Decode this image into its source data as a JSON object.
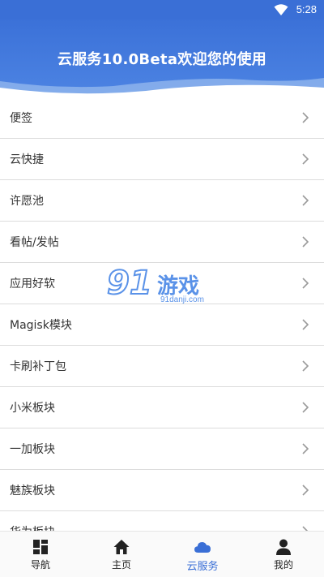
{
  "status": {
    "time": "5:28"
  },
  "header": {
    "title": "云服务10.0Beta欢迎您的使用"
  },
  "list": {
    "items": [
      {
        "label": "便签"
      },
      {
        "label": "云快捷"
      },
      {
        "label": "许愿池"
      },
      {
        "label": "看帖/发帖"
      },
      {
        "label": "应用好软"
      },
      {
        "label": "Magisk模块"
      },
      {
        "label": "卡刷补丁包"
      },
      {
        "label": "小米板块"
      },
      {
        "label": "一加板块"
      },
      {
        "label": "魅族板块"
      },
      {
        "label": "华为板块"
      }
    ]
  },
  "watermark": {
    "number": "91",
    "text": "游戏",
    "url": "91danji.com"
  },
  "tabbar": {
    "tabs": [
      {
        "label": "导航",
        "icon": "grid-icon"
      },
      {
        "label": "主页",
        "icon": "home-icon"
      },
      {
        "label": "云服务",
        "icon": "cloud-icon",
        "active": true
      },
      {
        "label": "我的",
        "icon": "user-icon"
      }
    ]
  },
  "colors": {
    "primary": "#3a6fd6",
    "text": "#333333",
    "divider": "#dcdcdc"
  }
}
